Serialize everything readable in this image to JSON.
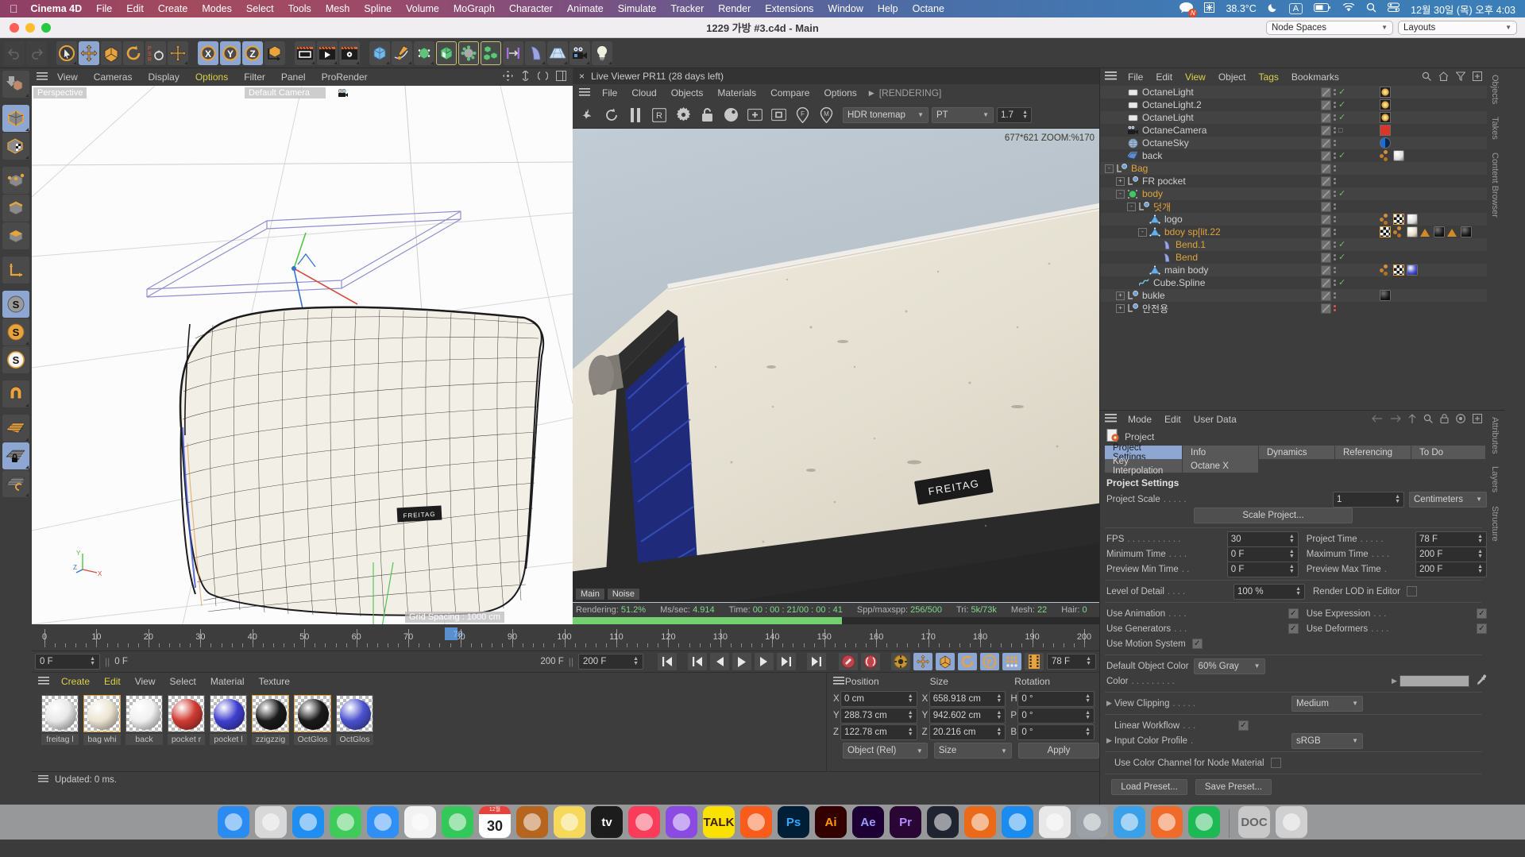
{
  "macbar": {
    "apple": "",
    "app": "Cinema 4D",
    "menus": [
      "File",
      "Edit",
      "Create",
      "Modes",
      "Select",
      "Tools",
      "Mesh",
      "Spline",
      "Volume",
      "MoGraph",
      "Character",
      "Animate",
      "Simulate",
      "Tracker",
      "Render",
      "Extensions",
      "Window",
      "Help",
      "Octane"
    ],
    "status": {
      "chat_badge": "N",
      "temperature": "38.3°C",
      "input_source": "A",
      "datetime": "12월 30일 (목) 오후  4:03"
    }
  },
  "window": {
    "title": "1229 가방 #3.c4d - Main",
    "node_spaces": "Node Spaces",
    "layouts": "Layouts"
  },
  "viewport_left": {
    "menus": [
      "View",
      "Cameras",
      "Display",
      "Options",
      "Filter",
      "Panel",
      "ProRender"
    ],
    "active_menu": "Options",
    "label_perspective": "Perspective",
    "label_camera": "Default Camera",
    "grid_spacing": "Grid Spacing : 1000 cm"
  },
  "live_viewer": {
    "title": "Live Viewer PR11 (28 days left)",
    "close": "×",
    "menus": [
      "File",
      "Cloud",
      "Objects",
      "Materials",
      "Compare",
      "Options"
    ],
    "rendering_label": "[RENDERING]",
    "tonemap": "HDR tonemap",
    "kernel": "PT",
    "exposure": "1.7",
    "zoom_info": "677*621 ZOOM:%170",
    "buffer_main": "Main",
    "buffer_noise": "Noise",
    "status": {
      "rendering_label": "Rendering:",
      "rendering_value": "51.2%",
      "mssec_label": "Ms/sec:",
      "mssec_value": "4.914",
      "time_label": "Time:",
      "time_value": "00 : 00 : 21/00 : 00 : 41",
      "spp_label": "Spp/maxspp:",
      "spp_value": "256/500",
      "tri_label": "Tri:",
      "tri_value": "5k/73k",
      "mesh_label": "Mesh:",
      "mesh_value": "22",
      "hair_label": "Hair:",
      "hair_value": "0",
      "progress_percent": 51.2
    }
  },
  "timeline": {
    "ticks": [
      0,
      10,
      20,
      30,
      40,
      50,
      60,
      70,
      80,
      90,
      100,
      110,
      120,
      130,
      140,
      150,
      160,
      170,
      180,
      190,
      200
    ],
    "current_frame": 78,
    "current_frame_label": "78",
    "field_start": "0 F",
    "field_preview_start": "0 F",
    "field_preview_end": "200 F",
    "field_end": "200 F",
    "field_current": "78 F"
  },
  "materials": {
    "menus": [
      "Create",
      "Edit",
      "View",
      "Select",
      "Material",
      "Texture"
    ],
    "items": [
      {
        "label": "freitag l",
        "color": "#e8e8e8",
        "selected": false
      },
      {
        "label": "bag whi",
        "color": "#ece4d2",
        "selected": true
      },
      {
        "label": "back",
        "color": "#f0f0f0",
        "selected": false
      },
      {
        "label": "pocket r",
        "color": "#cf3b32",
        "selected": false
      },
      {
        "label": "pocket l",
        "color": "#3f3fd0",
        "selected": false
      },
      {
        "label": "zzigzzig",
        "color": "#1a1a1a",
        "selected": true
      },
      {
        "label": "OctGlos",
        "color": "#1a1a1a",
        "selected": true
      },
      {
        "label": "OctGlos",
        "color": "#4b52cf",
        "selected": false
      }
    ]
  },
  "coordinates": {
    "headers": [
      "Position",
      "Size",
      "Rotation"
    ],
    "rows": [
      {
        "axis1": "X",
        "pos": "0 cm",
        "axis2": "X",
        "size": "658.918 cm",
        "axis3": "H",
        "rot": "0 °"
      },
      {
        "axis1": "Y",
        "pos": "288.73 cm",
        "axis2": "Y",
        "size": "942.602 cm",
        "axis3": "P",
        "rot": "0 °"
      },
      {
        "axis1": "Z",
        "pos": "122.78 cm",
        "axis2": "Z",
        "size": "20.216 cm",
        "axis3": "B",
        "rot": "0 °"
      }
    ],
    "mode_select": "Object (Rel)",
    "size_select": "Size",
    "apply_button": "Apply"
  },
  "statusbar": {
    "text": "Updated: 0 ms."
  },
  "object_manager": {
    "menus": [
      "File",
      "Edit",
      "View",
      "Object",
      "Tags",
      "Bookmarks"
    ],
    "active_menus": [
      "View",
      "Tags"
    ],
    "side_tabs": [
      "Objects",
      "Takes",
      "Content Browser"
    ],
    "items": [
      {
        "name": "OctaneLight",
        "depth": 1,
        "icon": "light",
        "color": "#d0d0d0",
        "expander": "",
        "check": true,
        "tags": [
          "light"
        ]
      },
      {
        "name": "OctaneLight.2",
        "depth": 1,
        "icon": "light",
        "color": "#d0d0d0",
        "expander": "",
        "check": true,
        "tags": [
          "light"
        ]
      },
      {
        "name": "OctaneLight",
        "depth": 1,
        "icon": "light",
        "color": "#d0d0d0",
        "expander": "",
        "check": true,
        "tags": [
          "light"
        ]
      },
      {
        "name": "OctaneCamera",
        "depth": 1,
        "icon": "camera",
        "color": "#d0d0d0",
        "expander": "",
        "check": false,
        "tags": [
          "cam"
        ]
      },
      {
        "name": "OctaneSky",
        "depth": 1,
        "icon": "sky",
        "color": "#d0d0d0",
        "expander": "",
        "check": false,
        "tags": [
          "sky"
        ]
      },
      {
        "name": "back",
        "depth": 1,
        "icon": "plane",
        "color": "#d0d0d0",
        "expander": "",
        "check": true,
        "tags": [
          "dots",
          "whiteball"
        ]
      },
      {
        "name": "Bag",
        "depth": 0,
        "icon": "null",
        "color": "#e0a33c",
        "expander": "-",
        "check": false,
        "tags": []
      },
      {
        "name": "FR pocket",
        "depth": 1,
        "icon": "null",
        "color": "#d0d0d0",
        "expander": "+",
        "check": false,
        "tags": []
      },
      {
        "name": "body",
        "depth": 1,
        "icon": "greenball",
        "color": "#e0a33c",
        "expander": "-",
        "check": true,
        "tags": []
      },
      {
        "name": "덧개",
        "depth": 2,
        "icon": "null",
        "color": "#e0a33c",
        "expander": "-",
        "check": false,
        "tags": []
      },
      {
        "name": "logo",
        "depth": 3,
        "icon": "poly",
        "color": "#d0d0d0",
        "expander": "",
        "check": false,
        "tags": [
          "dots",
          "checker",
          "whiteball"
        ]
      },
      {
        "name": "bdoy sp[lit.22",
        "depth": 3,
        "icon": "poly",
        "color": "#e0a33c",
        "expander": "-",
        "check": false,
        "tags": [
          "checker",
          "dots",
          "creamball",
          "tri",
          "darkball",
          "tri",
          "darkball"
        ]
      },
      {
        "name": "Bend.1",
        "depth": 4,
        "icon": "bend",
        "color": "#e0a33c",
        "expander": "",
        "check": true,
        "tags": []
      },
      {
        "name": "Bend",
        "depth": 4,
        "icon": "bend",
        "color": "#e0a33c",
        "expander": "",
        "check": true,
        "tags": []
      },
      {
        "name": "main body",
        "depth": 3,
        "icon": "poly",
        "color": "#d0d0d0",
        "expander": "",
        "check": false,
        "tags": [
          "dots",
          "checker",
          "blueball"
        ]
      },
      {
        "name": "Cube.Spline",
        "depth": 2,
        "icon": "spline",
        "color": "#d0d0d0",
        "expander": "",
        "check": true,
        "tags": []
      },
      {
        "name": "bukle",
        "depth": 1,
        "icon": "null",
        "color": "#d0d0d0",
        "expander": "+",
        "check": false,
        "tags": [
          "darkball"
        ]
      },
      {
        "name": "안전용",
        "depth": 1,
        "icon": "null",
        "color": "#d0d0d0",
        "expander": "+",
        "check": false,
        "reddots": true,
        "tags": []
      }
    ]
  },
  "attributes": {
    "menus": [
      "Mode",
      "Edit",
      "User Data"
    ],
    "side_tabs": [
      "Attributes",
      "Layers",
      "Structure"
    ],
    "object_label": "Project",
    "tabs_row1": [
      "Project Settings",
      "Info",
      "Dynamics",
      "Referencing",
      "To Do"
    ],
    "tabs_row2": [
      "Key Interpolation",
      "Octane X"
    ],
    "active_tab": "Project Settings",
    "section_title": "Project Settings",
    "fields": {
      "project_scale_label": "Project Scale",
      "project_scale_value": "1",
      "project_units": "Centimeters",
      "scale_project_button": "Scale Project...",
      "fps_label": "FPS",
      "fps_value": "30",
      "project_time_label": "Project Time",
      "project_time_value": "78 F",
      "min_time_label": "Minimum Time",
      "min_time_value": "0 F",
      "max_time_label": "Maximum Time",
      "max_time_value": "200 F",
      "prev_min_label": "Preview Min Time",
      "prev_min_value": "0 F",
      "prev_max_label": "Preview Max Time",
      "prev_max_value": "200 F",
      "lod_label": "Level of Detail",
      "lod_value": "100 %",
      "render_lod_label": "Render LOD in Editor",
      "render_lod_checked": false,
      "use_animation_label": "Use Animation",
      "use_animation_checked": true,
      "use_expression_label": "Use Expression",
      "use_expression_checked": true,
      "use_generators_label": "Use Generators",
      "use_generators_checked": true,
      "use_deformers_label": "Use Deformers",
      "use_deformers_checked": true,
      "use_motion_label": "Use Motion System",
      "use_motion_checked": true,
      "default_color_label": "Default Object Color",
      "default_color_value": "60% Gray",
      "color_label": "Color",
      "color_swatch": "#a8a8a8",
      "view_clipping_label": "View Clipping",
      "view_clipping_value": "Medium",
      "linear_workflow_label": "Linear Workflow",
      "linear_workflow_checked": true,
      "input_profile_label": "Input Color Profile",
      "input_profile_value": "sRGB",
      "node_material_label": "Use Color Channel for Node Material",
      "node_material_checked": false,
      "load_preset": "Load Preset...",
      "save_preset": "Save Preset..."
    }
  },
  "dock": {
    "items": [
      {
        "name": "finder",
        "label": "",
        "bg": "#2a8cf0"
      },
      {
        "name": "launchpad",
        "label": "",
        "bg": "#d8d8d8"
      },
      {
        "name": "safari",
        "label": "",
        "bg": "#1f8ef1"
      },
      {
        "name": "messages",
        "label": "",
        "bg": "#3ecb5a"
      },
      {
        "name": "mail",
        "label": "",
        "bg": "#2f8ff5"
      },
      {
        "name": "photos",
        "label": "",
        "bg": "#f2f2f2"
      },
      {
        "name": "facetime",
        "label": "",
        "bg": "#34c759"
      },
      {
        "name": "calendar",
        "label": "30",
        "bg": "#ffffff"
      },
      {
        "name": "contacts",
        "label": "",
        "bg": "#b5651d"
      },
      {
        "name": "notes",
        "label": "",
        "bg": "#f6d95a"
      },
      {
        "name": "appletv",
        "label": "tv",
        "bg": "#1c1c1c"
      },
      {
        "name": "music",
        "label": "",
        "bg": "#fa3c5a"
      },
      {
        "name": "podcasts",
        "label": "",
        "bg": "#8b4ae2"
      },
      {
        "name": "kakaotalk",
        "label": "TALK",
        "bg": "#fae100"
      },
      {
        "name": "strava",
        "label": "",
        "bg": "#f85b1a"
      },
      {
        "name": "photoshop",
        "label": "Ps",
        "bg": "#001e36"
      },
      {
        "name": "illustrator",
        "label": "Ai",
        "bg": "#330000"
      },
      {
        "name": "aftereffects",
        "label": "Ae",
        "bg": "#1d0033"
      },
      {
        "name": "premiere",
        "label": "Pr",
        "bg": "#2a0634"
      },
      {
        "name": "cinema4d",
        "label": "",
        "bg": "#1f2430"
      },
      {
        "name": "octane",
        "label": "",
        "bg": "#eb6a1a"
      },
      {
        "name": "appstore",
        "label": "",
        "bg": "#1a8cf0"
      },
      {
        "name": "preview",
        "label": "",
        "bg": "#e8e8e8"
      },
      {
        "name": "systemsettings",
        "label": "",
        "bg": "#9aa0a6"
      },
      {
        "name": "finder2",
        "label": "",
        "bg": "#3aa0e8"
      },
      {
        "name": "firefox",
        "label": "",
        "bg": "#f06a2a"
      },
      {
        "name": "spotify",
        "label": "",
        "bg": "#1db954"
      },
      {
        "name": "documents",
        "label": "DOC",
        "bg": "#c8c8c8"
      },
      {
        "name": "trash",
        "label": "",
        "bg": "#d0d0d0"
      }
    ]
  }
}
